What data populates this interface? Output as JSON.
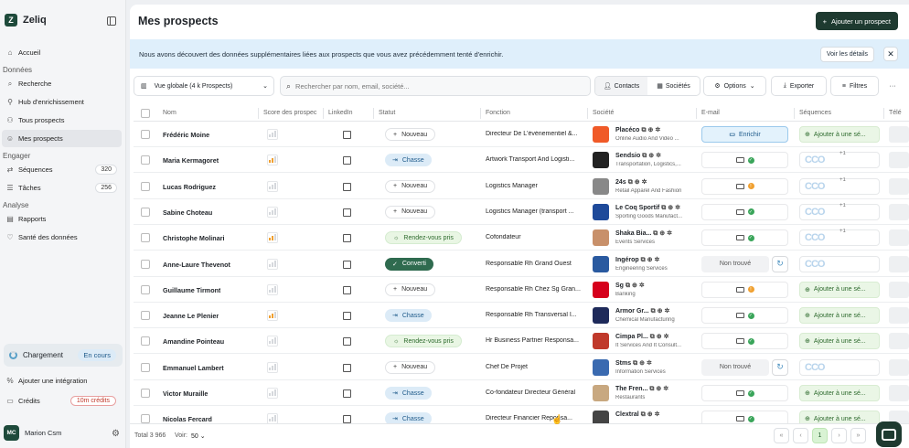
{
  "app": {
    "name": "Zeliq",
    "logo_letter": "Z"
  },
  "sidebar": {
    "top_items": [
      {
        "label": "Accueil",
        "icon": "home-icon"
      }
    ],
    "sections": [
      {
        "title": "Données",
        "items": [
          {
            "label": "Recherche",
            "icon": "search-icon"
          },
          {
            "label": "Hub d'enrichissement",
            "icon": "hub-icon"
          },
          {
            "label": "Tous prospects",
            "icon": "people-icon"
          },
          {
            "label": "Mes prospects",
            "icon": "user-icon",
            "active": true
          }
        ]
      },
      {
        "title": "Engager",
        "items": [
          {
            "label": "Séquences",
            "icon": "sequence-icon",
            "count": "320"
          },
          {
            "label": "Tâches",
            "icon": "tasks-icon",
            "count": "256"
          }
        ]
      },
      {
        "title": "Analyse",
        "items": [
          {
            "label": "Rapports",
            "icon": "chart-icon"
          },
          {
            "label": "Santé des données",
            "icon": "heart-icon"
          }
        ]
      }
    ],
    "loading": {
      "label": "Chargement",
      "badge": "En cours"
    },
    "integration": "Ajouter une intégration",
    "credits": {
      "label": "Crédits",
      "badge": "10m crédits"
    },
    "user": {
      "initials": "MC",
      "name": "Marion Csm"
    }
  },
  "header": {
    "title": "Mes prospects",
    "add_button": "Ajouter un prospect"
  },
  "banner": {
    "text": "Nous avons découvert des données supplémentaires liées aux prospects que vous avez précédemment tenté d'enrichir.",
    "details_button": "Voir les détails",
    "close": "✕"
  },
  "toolbar": {
    "view": "Vue globale (4 k Prospects)",
    "search_placeholder": "Rechercher par nom, email, société...",
    "contacts": "Contacts",
    "societes": "Sociétés",
    "options": "Options",
    "export": "Exporter",
    "filters": "Filtres",
    "more": "···"
  },
  "columns": [
    "Nom",
    "Score des prospects",
    "LinkedIn",
    "Statut",
    "Fonction",
    "Société",
    "E-mail",
    "Séquences",
    "Télé"
  ],
  "columns_display": [
    "Nom",
    "Score des prospec",
    "LinkedIn",
    "Statut",
    "Fonction",
    "Société",
    "E-mail",
    "Séquences",
    "Télé"
  ],
  "status_labels": {
    "nouveau": "Nouveau",
    "chasse": "Chasse",
    "rdv": "Rendez-vous pris",
    "converti": "Converti"
  },
  "email_labels": {
    "enrich": "Enrichir",
    "not_found": "Non trouvé"
  },
  "sequence_labels": {
    "add": "Ajouter à une sé...",
    "cco": "CCO",
    "plus": "+1"
  },
  "rows": [
    {
      "name": "Frédéric Moine",
      "score": 0,
      "status": "nouveau",
      "fonction": "Directeur De L'événementiel &...",
      "company": "Placéco",
      "industry": "Online Audio And Video ...",
      "logo_color": "#f05a28",
      "email": "enrich",
      "seq": "add"
    },
    {
      "name": "Maria Kermagoret",
      "score": 1,
      "status": "chasse",
      "fonction": "Artwork Transport And Logisti...",
      "company": "Sendsio",
      "industry": "Transportation, Logistics,...",
      "logo_color": "#222222",
      "email": "ok",
      "seq": "cco"
    },
    {
      "name": "Lucas Rodriguez",
      "score": 0,
      "status": "nouveau",
      "fonction": "Logistics Manager",
      "company": "24s",
      "industry": "Retail Apparel And Fashion",
      "logo_color": "#888888",
      "email": "warn",
      "seq": "cco"
    },
    {
      "name": "Sabine Choteau",
      "score": 0,
      "status": "nouveau",
      "fonction": "Logistics Manager (transport ...",
      "company": "Le Coq Sportif",
      "industry": "Sporting Goods Manufact...",
      "logo_color": "#1e4a9a",
      "email": "ok",
      "seq": "cco"
    },
    {
      "name": "Christophe Molinari",
      "score": 1,
      "status": "rdv",
      "fonction": "Cofondateur",
      "company": "Shaka Bia...",
      "industry": "Events Services",
      "logo_color": "#c8906a",
      "email": "ok",
      "seq": "cco"
    },
    {
      "name": "Anne-Laure Thevenot",
      "score": 0,
      "status": "converti",
      "fonction": "Responsable Rh Grand Ouest",
      "company": "Ingérop",
      "industry": "Engineering Services",
      "logo_color": "#2a5aa0",
      "email": "not_found",
      "seq": "cco_only"
    },
    {
      "name": "Guillaume Tirmont",
      "score": 0,
      "status": "nouveau",
      "fonction": "Responsable Rh Chez Sg Gran...",
      "company": "Sg",
      "industry": "Banking",
      "logo_color": "#d6001c",
      "email": "warn",
      "seq": "add"
    },
    {
      "name": "Jeanne Le Plenier",
      "score": 1,
      "status": "chasse",
      "fonction": "Responsable Rh Transversal I...",
      "company": "Armor Gr...",
      "industry": "Chemical Manufacturing",
      "logo_color": "#1e2a5a",
      "email": "ok",
      "seq": "add"
    },
    {
      "name": "Amandine Pointeau",
      "score": 0,
      "status": "rdv",
      "fonction": "Hr Business Partner Responsa...",
      "company": "Cimpa Pl...",
      "industry": "It Services And It Consult...",
      "logo_color": "#c0392b",
      "email": "ok",
      "seq": "add"
    },
    {
      "name": "Emmanuel Lambert",
      "score": 0,
      "status": "nouveau",
      "fonction": "Chef De Projet",
      "company": "Stms",
      "industry": "Information Services",
      "logo_color": "#3a6ab0",
      "email": "not_found",
      "seq": "cco_only"
    },
    {
      "name": "Victor Muraille",
      "score": 0,
      "status": "chasse",
      "fonction": "Co-fondateur Directeur Général",
      "company": "The Fren...",
      "industry": "Restaurants",
      "logo_color": "#c8a880",
      "email": "ok",
      "seq": "add"
    },
    {
      "name": "Nicolas Fercard",
      "score": 0,
      "status": "chasse",
      "fonction": "Directeur Financier Reponsa...",
      "company": "Clextral",
      "industry": "",
      "logo_color": "#444444",
      "email": "ok",
      "seq": "add"
    }
  ],
  "footer": {
    "total": "Total 3 966",
    "per_page_label": "Voir:",
    "per_page": "50",
    "current_page": "1"
  },
  "colors": {
    "brand": "#1e3a30",
    "chasse": "#dcebf7",
    "rdv": "#e9f6e4",
    "converti": "#2f6b4f",
    "banner": "#dfeffb"
  }
}
